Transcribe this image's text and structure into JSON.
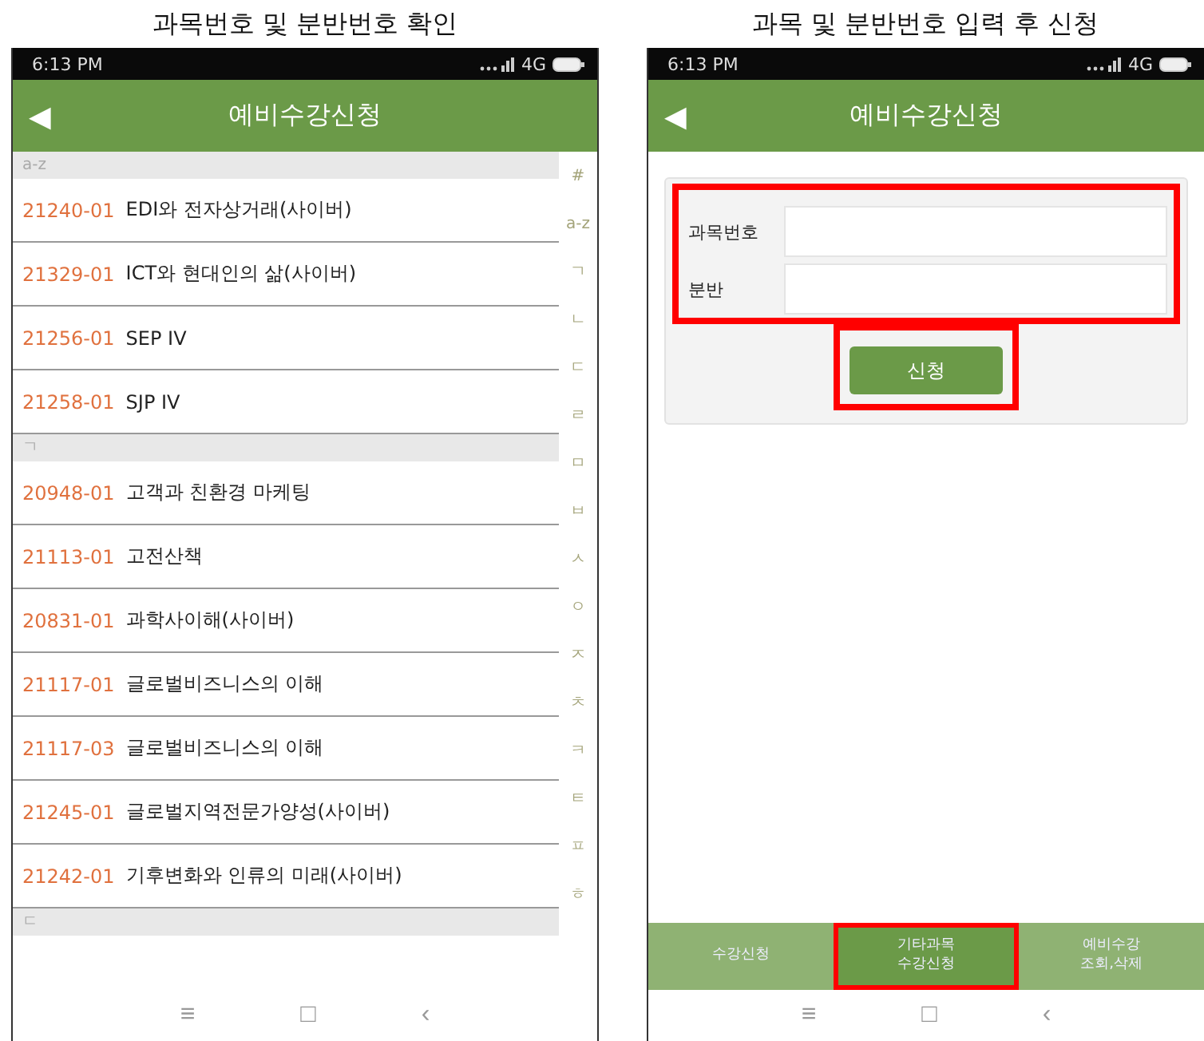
{
  "panels": [
    {
      "caption": "과목번호 및 분반번호 확인",
      "status_bar": {
        "time": "6:13 PM",
        "network": "4G"
      },
      "header": {
        "back": "◀",
        "title": "예비수강신청"
      },
      "list": [
        {
          "kind": "section",
          "label": "a-z"
        },
        {
          "kind": "course",
          "code": "21240-01",
          "name": "EDI와 전자상거래(사이버)"
        },
        {
          "kind": "course",
          "code": "21329-01",
          "name": "ICT와 현대인의 삶(사이버)"
        },
        {
          "kind": "course",
          "code": "21256-01",
          "name": "SEP IV"
        },
        {
          "kind": "course",
          "code": "21258-01",
          "name": "SJP IV"
        },
        {
          "kind": "section",
          "label": "ㄱ"
        },
        {
          "kind": "course",
          "code": "20948-01",
          "name": "고객과 친환경 마케팅"
        },
        {
          "kind": "course",
          "code": "21113-01",
          "name": "고전산책"
        },
        {
          "kind": "course",
          "code": "20831-01",
          "name": "과학사이해(사이버)"
        },
        {
          "kind": "course",
          "code": "21117-01",
          "name": "글로벌비즈니스의 이해"
        },
        {
          "kind": "course",
          "code": "21117-03",
          "name": "글로벌비즈니스의 이해"
        },
        {
          "kind": "course",
          "code": "21245-01",
          "name": "글로벌지역전문가양성(사이버)"
        },
        {
          "kind": "course",
          "code": "21242-01",
          "name": "기후변화와 인류의 미래(사이버)"
        },
        {
          "kind": "section",
          "label": "ㄷ"
        }
      ],
      "index": [
        "#",
        "a-z",
        "ㄱ",
        "ㄴ",
        "ㄷ",
        "ㄹ",
        "ㅁ",
        "ㅂ",
        "ㅅ",
        "ㅇ",
        "ㅈ",
        "ㅊ",
        "ㅋ",
        "ㅌ",
        "ㅍ",
        "ㅎ"
      ],
      "nav": [
        "≡",
        "□",
        "‹"
      ]
    },
    {
      "caption": "과목 및 분반번호 입력 후 신청",
      "status_bar": {
        "time": "6:13 PM",
        "network": "4G"
      },
      "header": {
        "back": "◀",
        "title": "예비수강신청"
      },
      "form": {
        "highlighted": true,
        "fields": [
          {
            "label": "과목번호"
          },
          {
            "label": "분반"
          }
        ],
        "submit": {
          "label": "신청",
          "highlighted": true
        }
      },
      "tabs": [
        {
          "label": "수강신청",
          "selected": false,
          "highlighted": false
        },
        {
          "label": "기타과목\n수강신청",
          "selected": true,
          "highlighted": true
        },
        {
          "label": "예비수강\n조회,삭제",
          "selected": false,
          "highlighted": false
        }
      ],
      "nav": [
        "≡",
        "□",
        "‹"
      ]
    }
  ]
}
